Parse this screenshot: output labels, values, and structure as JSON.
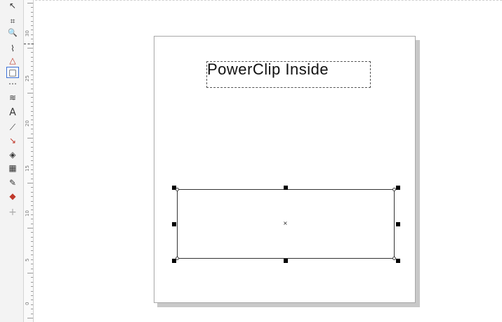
{
  "toolbox": {
    "tools": [
      {
        "name": "pick-tool-icon",
        "glyph": "↖"
      },
      {
        "name": "crop-tool-icon",
        "glyph": "⌗"
      },
      {
        "name": "zoom-tool-icon",
        "glyph": "🔍"
      },
      {
        "name": "freehand-tool-icon",
        "glyph": "⌇"
      },
      {
        "name": "smart-fill-tool-icon",
        "glyph": "△"
      },
      {
        "name": "rectangle-tool-icon",
        "glyph": "□"
      },
      {
        "name": "polygon-tool-icon",
        "glyph": "⋯"
      },
      {
        "name": "artistic-media-tool-icon",
        "glyph": "≋"
      },
      {
        "name": "text-tool-icon",
        "glyph": "A"
      },
      {
        "name": "connector-tool-icon",
        "glyph": "⟋"
      },
      {
        "name": "drop-shadow-tool-icon",
        "glyph": "↘"
      },
      {
        "name": "transparency-tool-icon",
        "glyph": "◈"
      },
      {
        "name": "pattern-tool-icon",
        "glyph": "▦"
      },
      {
        "name": "eyedropper-tool-icon",
        "glyph": "✎"
      },
      {
        "name": "interactive-fill-tool-icon",
        "glyph": "◆"
      },
      {
        "name": "add-tool-icon",
        "glyph": "+"
      }
    ]
  },
  "ruler": {
    "labels": [
      "30",
      "25",
      "20",
      "15",
      "10",
      "5",
      "0"
    ]
  },
  "canvas": {
    "title_text": "PowerClip Inside",
    "center_marker": "×"
  },
  "colors": {
    "selection_accent": "#3b6fd4",
    "handle": "#000000"
  }
}
